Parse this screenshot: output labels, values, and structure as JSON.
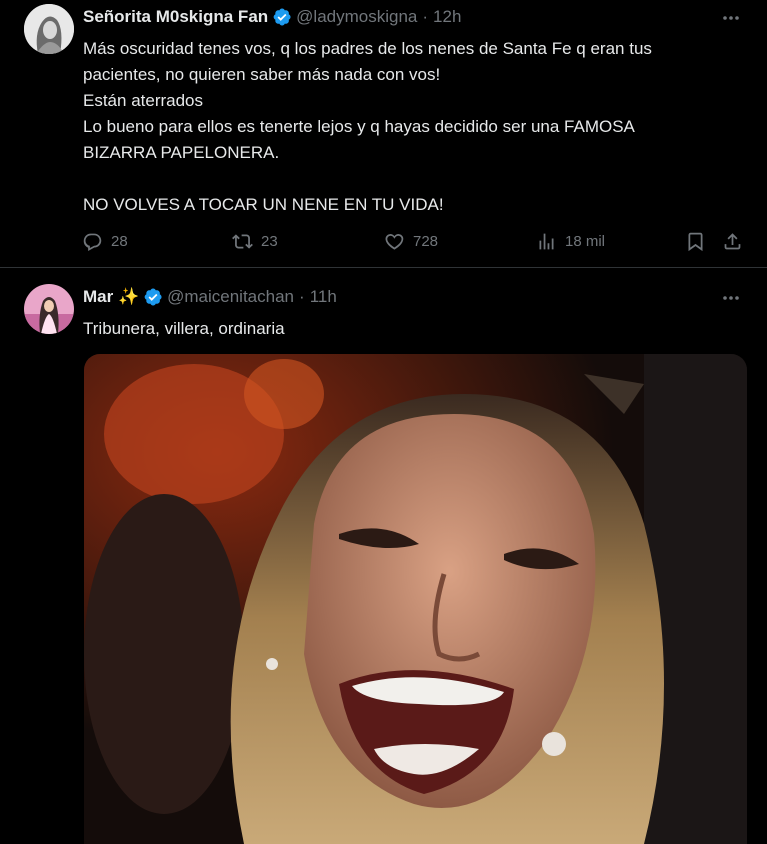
{
  "tweets": [
    {
      "name": "Señorita M0skigna Fan",
      "handle": "@ladymoskigna",
      "dot": "·",
      "time": "12h",
      "text_lines": [
        "Más oscuridad tenes vos, q los padres de los nenes de Santa Fe q eran tus",
        "pacientes, no quieren saber más nada con vos!",
        "Están aterrados",
        "Lo bueno para ellos es tenerte lejos y q hayas decidido ser una FAMOSA",
        "BIZARRA PAPELONERA.",
        "",
        "NO VOLVES A TOCAR UN NENE EN TU VIDA!"
      ],
      "replies": "28",
      "reposts": "23",
      "likes": "728",
      "views": "18 mil"
    },
    {
      "name": "Mar ✨",
      "handle": "@maicenitachan",
      "dot": "·",
      "time": "11h",
      "text_lines": [
        "Tribunera, villera, ordinaria"
      ]
    }
  ],
  "icons": {
    "verified": "verified-badge-icon",
    "more": "more-icon",
    "reply": "reply-icon",
    "repost": "repost-icon",
    "like": "like-icon",
    "views": "views-icon",
    "bookmark": "bookmark-icon",
    "share": "share-icon"
  },
  "colors": {
    "background": "#000000",
    "text": "#e7e9ea",
    "secondary": "#71767b",
    "verified": "#1d9bf0",
    "divider": "#2f3336"
  }
}
